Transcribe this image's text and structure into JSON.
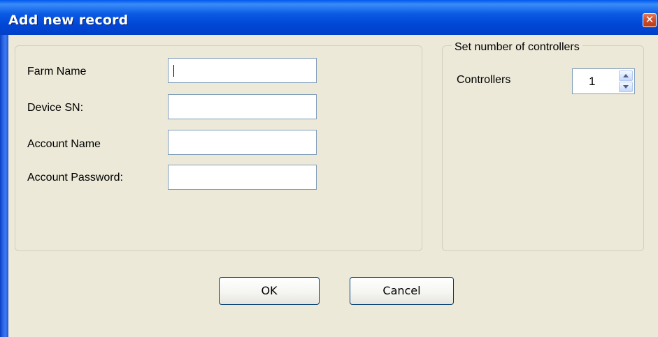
{
  "window": {
    "title": "Add new record",
    "close_glyph": "✕"
  },
  "form": {
    "fields": [
      {
        "label": "Farm Name",
        "value": "",
        "focused": true
      },
      {
        "label": "Device SN:",
        "value": ""
      },
      {
        "label": "Account Name",
        "value": ""
      },
      {
        "label": "Account Password:",
        "value": ""
      }
    ]
  },
  "controllers_group": {
    "title": "Set number of controllers",
    "label": "Controllers",
    "value": "1"
  },
  "buttons": {
    "ok": "OK",
    "cancel": "Cancel"
  },
  "colors": {
    "titlebar": "#0a5ae4",
    "dialog_bg": "#ece9d8",
    "close_button": "#d0502e",
    "button_border": "#003c74",
    "input_border": "#7f9db9"
  },
  "icons": {
    "close": "close-icon",
    "spin_up": "chevron-up-icon",
    "spin_down": "chevron-down-icon"
  }
}
